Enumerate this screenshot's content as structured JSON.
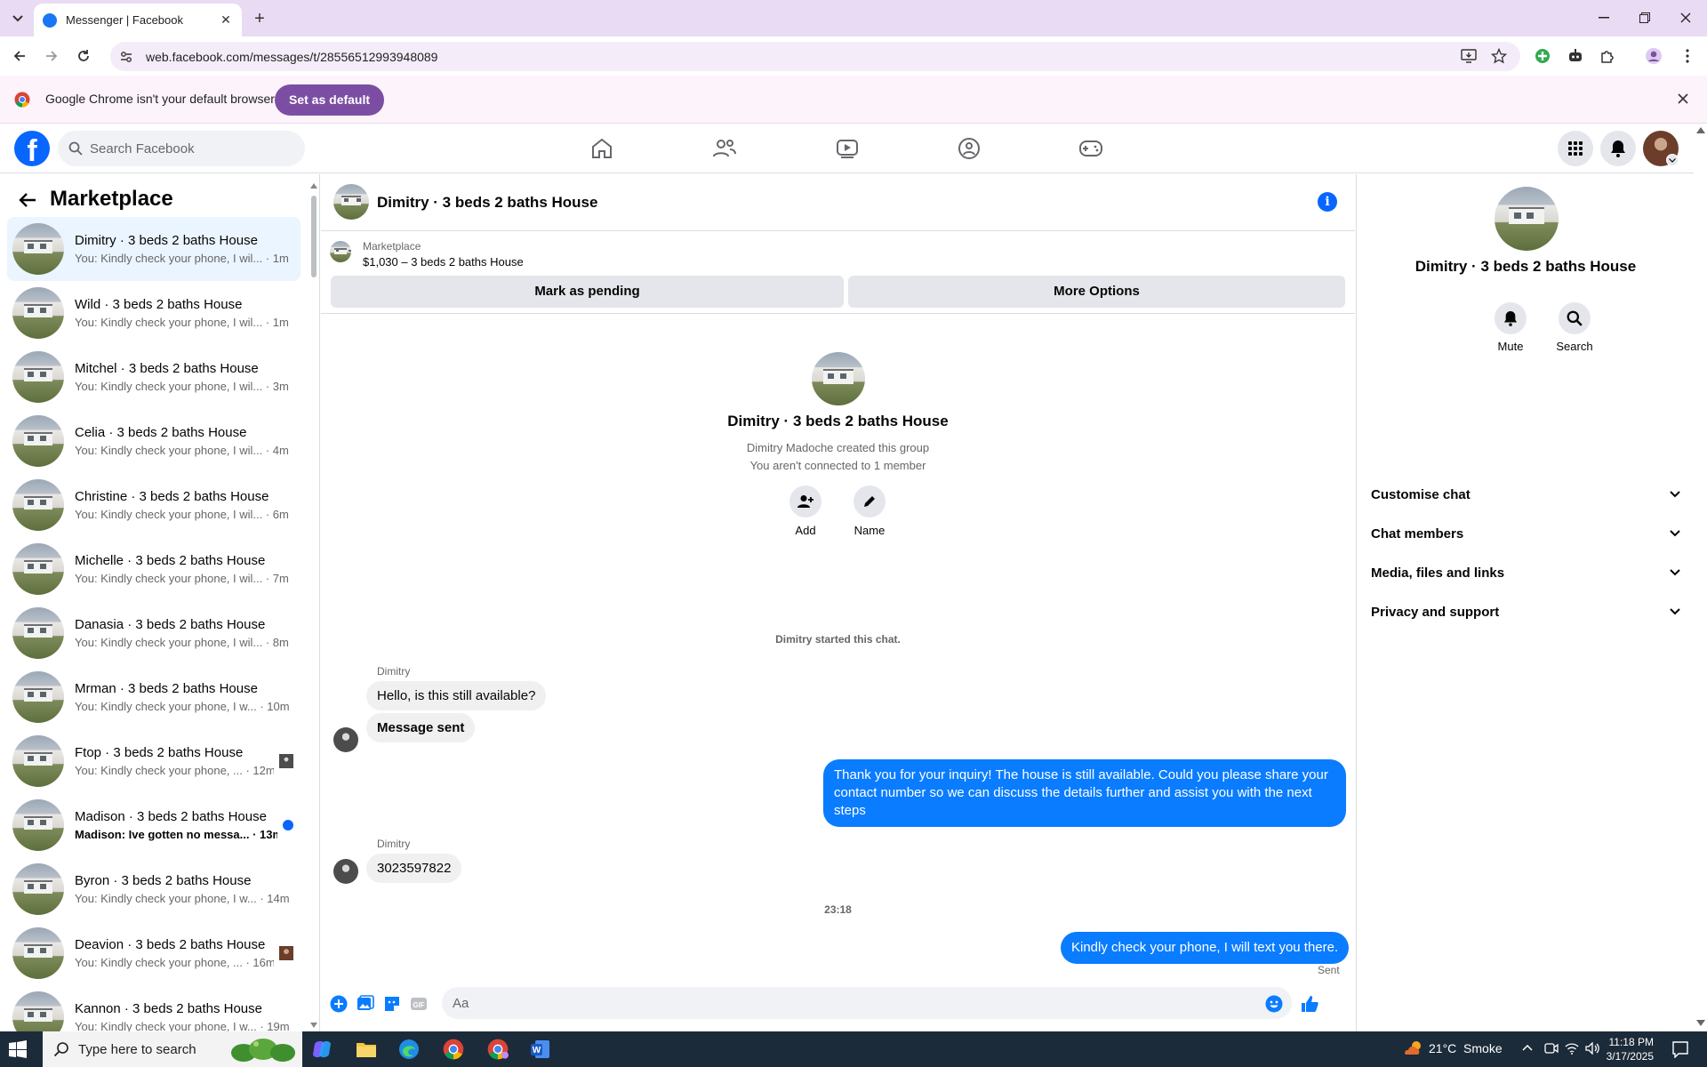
{
  "browser": {
    "tab_title": "Messenger | Facebook",
    "url": "web.facebook.com/messages/t/28556512993948089",
    "infobar_message": "Google Chrome isn't your default browser",
    "set_default_label": "Set as default"
  },
  "facebook": {
    "search_placeholder": "Search Facebook",
    "brand_color": "#0866ff"
  },
  "sidebar": {
    "title": "Marketplace",
    "conversations": [
      {
        "name": "Dimitry · 3 beds 2 baths House",
        "preview": "You: Kindly check your phone, I wil... · 1m",
        "active": true
      },
      {
        "name": "Wild · 3 beds 2 baths House",
        "preview": "You: Kindly check your phone, I wil... · 1m"
      },
      {
        "name": "Mitchel · 3 beds 2 baths House",
        "preview": "You: Kindly check your phone, I wil... · 3m"
      },
      {
        "name": "Celia · 3 beds 2 baths House",
        "preview": "You: Kindly check your phone, I wil... · 4m"
      },
      {
        "name": "Christine · 3 beds 2 baths House",
        "preview": "You: Kindly check your phone, I wil... · 6m"
      },
      {
        "name": "Michelle · 3 beds 2 baths House",
        "preview": "You: Kindly check your phone, I wil... · 7m"
      },
      {
        "name": "Danasia · 3 beds 2 baths House",
        "preview": "You: Kindly check your phone, I wil... · 8m"
      },
      {
        "name": "Mrman · 3 beds 2 baths House",
        "preview": "You: Kindly check your phone, I w... · 10m"
      },
      {
        "name": "Ftop · 3 beds 2 baths House",
        "preview": "You: Kindly check your phone, ... · 12m",
        "mini": "person"
      },
      {
        "name": "Madison · 3 beds 2 baths House",
        "preview": "Madison: Ive gotten no messa... · 13m",
        "unread": true
      },
      {
        "name": "Byron · 3 beds 2 baths House",
        "preview": "You: Kindly check your phone, I w... · 14m"
      },
      {
        "name": "Deavion · 3 beds 2 baths House",
        "preview": "You: Kindly check your phone, ... · 16m",
        "mini": "person2"
      },
      {
        "name": "Kannon · 3 beds 2 baths House",
        "preview": "You: Kindly check your phone, I w... · 19m"
      }
    ]
  },
  "chat": {
    "title": "Dimitry · 3 beds 2 baths House",
    "marketplace_label": "Marketplace",
    "listing": "$1,030 – 3 beds 2 baths House",
    "mark_pending_label": "Mark as pending",
    "more_options_label": "More Options",
    "group_name": "Dimitry · 3 beds 2 baths House",
    "created_by": "Dimitry Madoche created this group",
    "connection_note": "You aren't connected to 1 member",
    "add_label": "Add",
    "name_label": "Name",
    "started_note": "Dimitry started this chat.",
    "messages": {
      "sender_1": "Dimitry",
      "in_1": "Hello, is this still available?",
      "in_2": "Message sent",
      "out_1": "Thank you for your inquiry! The house is still available. Could you please share your contact number so we can discuss the details further and assist you with the next steps",
      "sender_2": "Dimitry",
      "in_3": "3023597822",
      "timestamp": "23:18",
      "out_2": "Kindly check your phone, I will text you there.",
      "status": "Sent"
    },
    "composer_placeholder": "Aa",
    "accent_color": "#0a7cff"
  },
  "right_panel": {
    "name": "Dimitry · 3 beds 2 baths House",
    "mute_label": "Mute",
    "search_label": "Search",
    "sections": [
      "Customise chat",
      "Chat members",
      "Media, files and links",
      "Privacy and support"
    ]
  },
  "taskbar": {
    "search_placeholder": "Type here to search",
    "weather": "21°C  Smoke",
    "time": "11:18 PM",
    "date": "3/17/2025"
  }
}
